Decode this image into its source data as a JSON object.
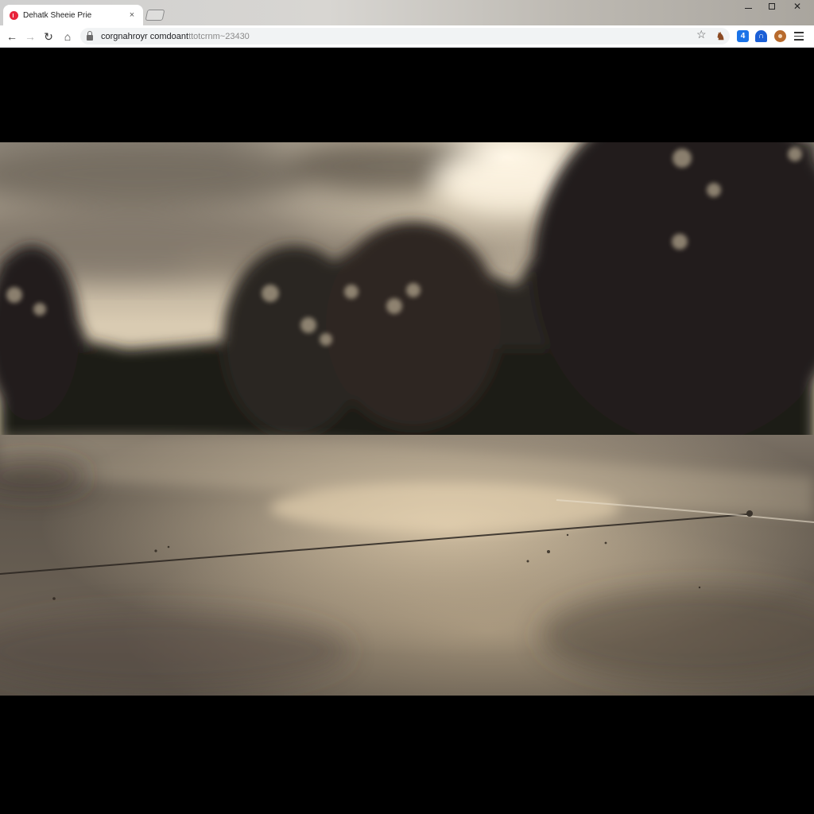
{
  "browser": {
    "tab": {
      "title": "Dehatk Sheeie Prie",
      "close_glyph": "×",
      "favicon_color": "#e8233a"
    },
    "window_controls": {
      "close_glyph": "✕"
    },
    "nav": {
      "back_glyph": "←",
      "forward_glyph": "→",
      "reload_glyph": "↻",
      "home_glyph": "⌂"
    },
    "address_bar": {
      "url_host": "corgnahroyr comdoant",
      "url_rest": "ttotcrnm~23430",
      "bookmark_glyph": "☆"
    },
    "extensions": [
      {
        "icon": "fox-icon",
        "label": "♞"
      },
      {
        "icon": "puzzle-icon",
        "label": "4",
        "color": "#1a73e8"
      },
      {
        "icon": "profile-icon",
        "label": "∩",
        "color": "#1b5fd6"
      },
      {
        "icon": "cookie-icon",
        "label": "",
        "color": "#b86a2c"
      }
    ]
  },
  "content": {
    "background_color": "#000000",
    "image": {
      "subject": "blurred-trees-wet-road-sunset"
    }
  }
}
